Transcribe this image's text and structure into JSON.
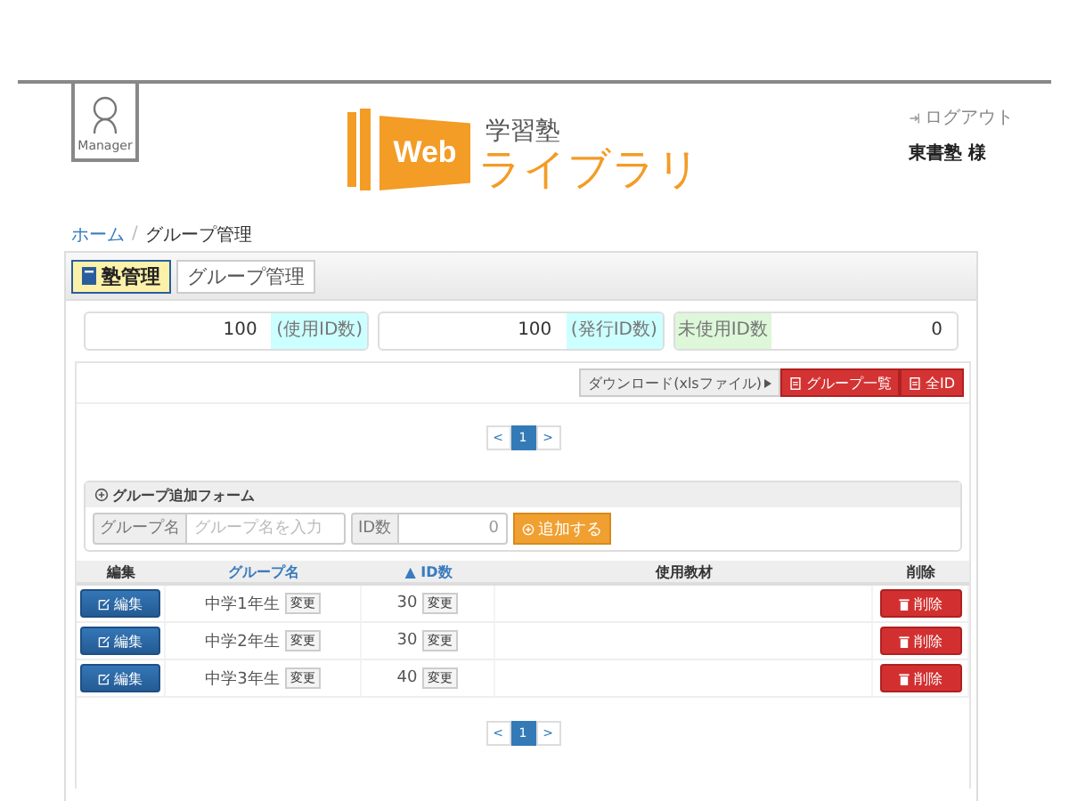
{
  "header": {
    "badge": "Manager",
    "logo": {
      "top": "学習塾",
      "mark": "Web",
      "name": "ライブラリ"
    },
    "logout": "ログアウト",
    "user": "東書塾 様"
  },
  "breadcrumb": {
    "items": [
      "ホーム",
      "グループ管理"
    ],
    "separator": "/"
  },
  "tabs": [
    {
      "label": "塾管理",
      "selected": true
    },
    {
      "label": "グループ管理",
      "selected": false
    }
  ],
  "stats": [
    {
      "kind": "value_first",
      "value": "100",
      "label": "(使用ID数)",
      "color": "#ccffff"
    },
    {
      "kind": "value_first",
      "value": "100",
      "label": "(発行ID数)",
      "color": "#ccffff"
    },
    {
      "kind": "label_first",
      "value": "0",
      "label": "未使用ID数",
      "color": "#ddf7d8"
    }
  ],
  "toolbar": {
    "download": "ダウンロード(xlsファイル)",
    "buttons": [
      "グループ一覧",
      "全ID"
    ]
  },
  "pagination_top": [
    {
      "label": "<",
      "selected": false
    },
    {
      "label": "1",
      "selected": true
    },
    {
      "label": ">",
      "selected": false
    }
  ],
  "form": {
    "title": "グループ追加フォーム",
    "name_label": "グループ名",
    "name_placeholder": "グループ名を入力",
    "count_label": "ID数",
    "count_value": "0",
    "submit": "追加する"
  },
  "table": {
    "columns": [
      {
        "label": "編集",
        "link": false
      },
      {
        "label": "グループ名",
        "link": true
      },
      {
        "label": "ID数",
        "link": true,
        "sort_mark": "▲"
      },
      {
        "label": "使用教材",
        "link": false
      },
      {
        "label": "削除",
        "link": false
      }
    ],
    "rows": [
      {
        "edit": "編集",
        "name": "中学1年生",
        "name_change": "変更",
        "ids": "30",
        "ids_change": "変更",
        "delete": "削除"
      },
      {
        "edit": "編集",
        "name": "中学2年生",
        "name_change": "変更",
        "ids": "30",
        "ids_change": "変更",
        "delete": "削除"
      },
      {
        "edit": "編集",
        "name": "中学3年生",
        "name_change": "変更",
        "ids": "40",
        "ids_change": "変更",
        "delete": "削除"
      }
    ]
  },
  "pagination_bottom": [
    {
      "label": "<",
      "selected": false
    },
    {
      "label": "1",
      "selected": true
    },
    {
      "label": ">",
      "selected": false
    }
  ]
}
